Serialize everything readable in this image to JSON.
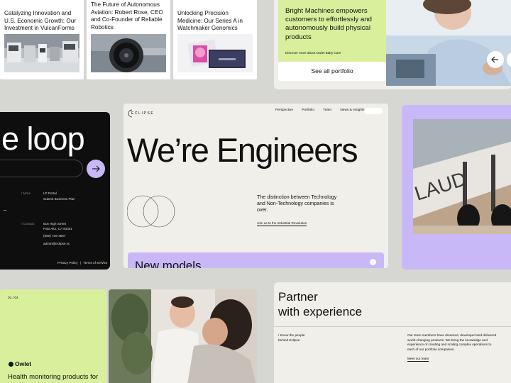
{
  "news_cards": [
    {
      "title": "Catalyzing Innovation and U.S. Economic Growth: Our Investment in VulcanForms"
    },
    {
      "title": "The Future of Autonomous Aviation: Robert Rose, CEO and Co-Founder of Reliable Robotics"
    },
    {
      "title": "Unlocking Precision Medicine: Our Series A in Watchmaker Genomics"
    }
  ],
  "bright_machines": {
    "headline": "Bright Machines empowers customers to effortlessly and autonomously build physical products",
    "link": "Discover more about Owlet Baby Care",
    "see_all": "See all portfolio"
  },
  "dark_card": {
    "headline": "e loop",
    "more_label": "/ More",
    "more_links": [
      "LP Portal",
      "Submit Business Plan"
    ],
    "contact_label": "/ Contact",
    "contact_lines": [
      "516 High Street",
      "Palo Alto, CA 94301",
      "",
      "(650) 729-4567",
      "",
      "admin@eclipse.vc"
    ],
    "privacy": "Privacy Policy",
    "sep": "|",
    "terms": "Terms of Service"
  },
  "center": {
    "logo": "ECLIPSE",
    "nav": [
      "Perspective",
      "Portfolio",
      "Team",
      "News & Insights"
    ],
    "headline": "We’re Engineers",
    "tagline": "The distinction between Technology and Non-Technology companies is over.",
    "cta": "Join us to the Industrial Revolution",
    "banner": "New models"
  },
  "owlet": {
    "counter": "01 / 04",
    "brand": "Owlet",
    "headline": "Health monitoring products for modern parenting"
  },
  "partner": {
    "headline_line1": "Partner",
    "headline_line2": "with experience",
    "left_label_1": "/ Knew the people",
    "left_label_2": "behind Eclipse",
    "body": "Our team members have dreamed, developed and delivered world-changing products. We bring the knowledge and experience of creating and scaling complex operations to each of our portfolio companies.",
    "link": "Meet our team"
  },
  "colors": {
    "lime": "#d8ef9c",
    "lavender": "#c9b8f7",
    "dark": "#0e0e0e",
    "cream": "#f1efea",
    "bg": "#d6d6d2"
  }
}
